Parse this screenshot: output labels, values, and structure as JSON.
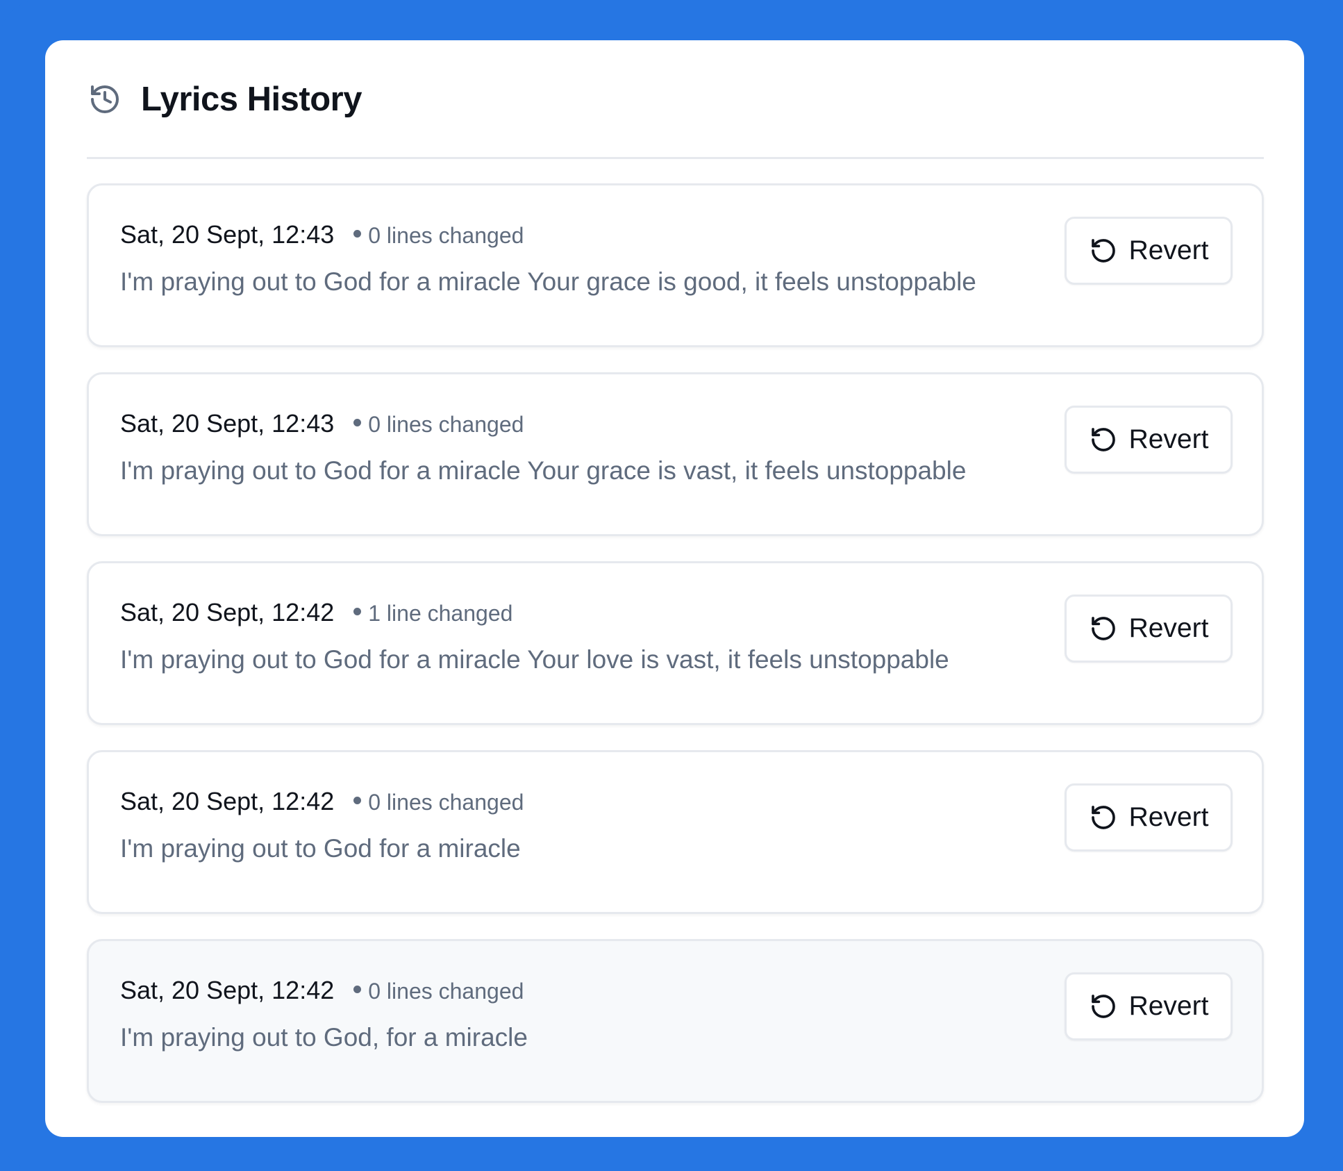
{
  "header": {
    "icon": "history-icon",
    "title": "Lyrics History"
  },
  "entries": [
    {
      "timestamp": "Sat, 20 Sept, 12:43",
      "changes": "0 lines changed",
      "lyric": "I'm praying out to God for a miracle Your grace is good, it feels unstoppable",
      "revert_label": "Revert"
    },
    {
      "timestamp": "Sat, 20 Sept, 12:43",
      "changes": "0 lines changed",
      "lyric": "I'm praying out to God for a miracle Your grace is vast, it feels unstoppable",
      "revert_label": "Revert"
    },
    {
      "timestamp": "Sat, 20 Sept, 12:42",
      "changes": "1 line changed",
      "lyric": "I'm praying out to God for a miracle Your love is vast, it feels unstoppable",
      "revert_label": "Revert"
    },
    {
      "timestamp": "Sat, 20 Sept, 12:42",
      "changes": "0 lines changed",
      "lyric": "I'm praying out to God for a miracle",
      "revert_label": "Revert"
    },
    {
      "timestamp": "Sat, 20 Sept, 12:42",
      "changes": "0 lines changed",
      "lyric": "I'm praying out to God, for a miracle",
      "revert_label": "Revert"
    }
  ],
  "colors": {
    "frame": "#2676e3",
    "panel": "#ffffff",
    "title_text": "#10141c",
    "secondary_text": "#5f6b7d",
    "border": "#e6e9ee",
    "highlighted_entry": "#f7f9fb"
  },
  "icons": {
    "revert": "rotate-ccw-icon"
  }
}
